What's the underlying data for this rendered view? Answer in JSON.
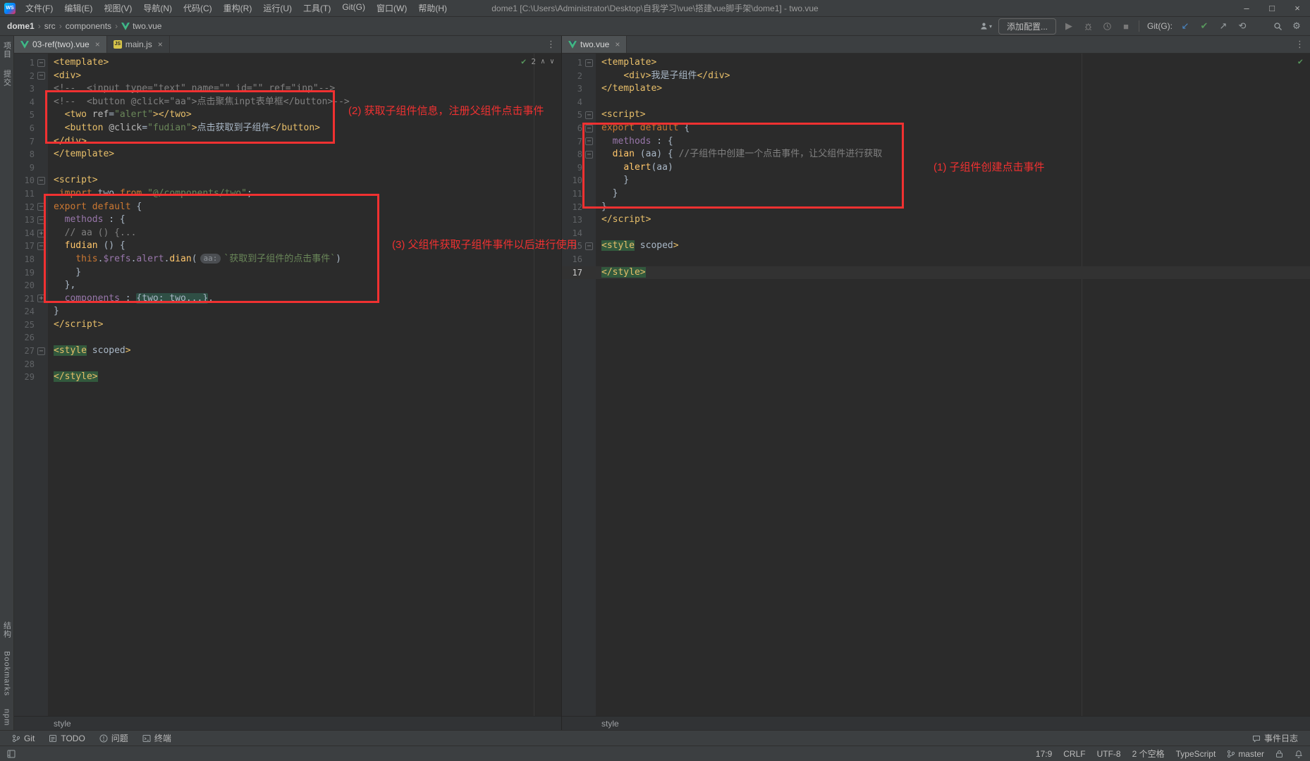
{
  "title_bar": {
    "logo": "WS",
    "menus": [
      "文件(F)",
      "编辑(E)",
      "视图(V)",
      "导航(N)",
      "代码(C)",
      "重构(R)",
      "运行(U)",
      "工具(T)",
      "Git(G)",
      "窗口(W)",
      "帮助(H)"
    ],
    "title": "dome1 [C:\\Users\\Administrator\\Desktop\\自我学习\\vue\\搭建vue脚手架\\dome1] - two.vue"
  },
  "toolbar": {
    "breadcrumbs": [
      {
        "label": "dome1"
      },
      {
        "label": "src"
      },
      {
        "label": "components"
      },
      {
        "label": "two.vue",
        "icon": "vue"
      }
    ],
    "add_config_label": "添加配置...",
    "git_label": "Git(G):"
  },
  "icons": {
    "close": "×",
    "kebab": "⋮",
    "crumb_sep": "›",
    "check": "✔",
    "chev_up": "∧",
    "chev_down": "∨",
    "play": "▶",
    "stop": "■",
    "gear": "⚙",
    "git_update": "↙",
    "git_commit": "✔",
    "git_push": "↗",
    "git_history": "⟲",
    "dropdown": "▾",
    "minimize": "–",
    "maximize": "□",
    "close_win": "×",
    "fold_open": "−",
    "fold_closed": "+"
  },
  "left_stripe": {
    "top": [
      "项目",
      "提交"
    ],
    "bottom": [
      "结构",
      "Bookmarks",
      "npm"
    ]
  },
  "panes": [
    {
      "tabs": [
        {
          "label": "03-ref(two).vue",
          "icon": "vue",
          "selected": true
        },
        {
          "label": "main.js",
          "icon": "js",
          "selected": false
        }
      ],
      "inspection": {
        "count": "2"
      },
      "breadcrumb": "style",
      "lines": [
        {
          "n": "1",
          "f": "m",
          "s": [
            [
              "tag",
              "<template>"
            ]
          ]
        },
        {
          "n": "2",
          "f": "m",
          "s": [
            [
              "tag",
              "<div>"
            ]
          ]
        },
        {
          "n": "3",
          "f": "",
          "s": [
            [
              "cmt",
              "<!--  <input type=\"text\" name=\"\" id=\"\" ref=\"inp\"-->"
            ]
          ]
        },
        {
          "n": "4",
          "f": "",
          "s": [
            [
              "cmt",
              "<!--  <button @click=\"aa\">点击聚焦inpt表单框</button>-->"
            ]
          ]
        },
        {
          "n": "5",
          "f": "",
          "s": [
            [
              "txt",
              "  "
            ],
            [
              "tag",
              "<two"
            ],
            [
              "attr",
              " ref"
            ],
            [
              "txt",
              "="
            ],
            [
              "str",
              "\"alert\""
            ],
            [
              "tag",
              "></two>"
            ]
          ]
        },
        {
          "n": "6",
          "f": "",
          "s": [
            [
              "txt",
              "  "
            ],
            [
              "tag",
              "<button"
            ],
            [
              "attr",
              " @click"
            ],
            [
              "txt",
              "="
            ],
            [
              "str",
              "\"fudian\""
            ],
            [
              "tag",
              ">"
            ],
            [
              "txt",
              "点击获取到子组件"
            ],
            [
              "tag",
              "</button>"
            ]
          ]
        },
        {
          "n": "7",
          "f": "",
          "s": [
            [
              "tag",
              "</div>"
            ]
          ]
        },
        {
          "n": "8",
          "f": "",
          "s": [
            [
              "tag",
              "</template>"
            ]
          ]
        },
        {
          "n": "9",
          "f": "",
          "s": []
        },
        {
          "n": "10",
          "f": "m",
          "s": [
            [
              "tag",
              "<script>"
            ]
          ]
        },
        {
          "n": "11",
          "f": "",
          "s": [
            [
              "txt",
              " "
            ],
            [
              "kw",
              "import "
            ],
            [
              "ident",
              "two"
            ],
            [
              "kw",
              " from "
            ],
            [
              "str",
              "\"@/components/two\""
            ],
            [
              "txt",
              ";"
            ]
          ]
        },
        {
          "n": "12",
          "f": "m",
          "s": [
            [
              "kw",
              "export default "
            ],
            [
              "txt",
              "{"
            ]
          ]
        },
        {
          "n": "13",
          "f": "m",
          "s": [
            [
              "txt",
              "  "
            ],
            [
              "prop",
              "methods"
            ],
            [
              "txt",
              " : {"
            ]
          ]
        },
        {
          "n": "14",
          "f": "p",
          "s": [
            [
              "txt",
              "  "
            ],
            [
              "cmt",
              "// aa () {..."
            ]
          ]
        },
        {
          "n": "17",
          "f": "m",
          "s": [
            [
              "txt",
              "  "
            ],
            [
              "fn",
              "fudian"
            ],
            [
              "txt",
              " () {"
            ]
          ]
        },
        {
          "n": "18",
          "f": "",
          "s": [
            [
              "txt",
              "    "
            ],
            [
              "kw",
              "this"
            ],
            [
              "txt",
              "."
            ],
            [
              "prop",
              "$refs"
            ],
            [
              "txt",
              "."
            ],
            [
              "prop",
              "alert"
            ],
            [
              "txt",
              "."
            ],
            [
              "fn",
              "dian"
            ],
            [
              "txt",
              "("
            ],
            [
              "hint",
              "aa:"
            ],
            [
              "str",
              "`获取到子组件的点击事件`"
            ],
            [
              "txt",
              ")"
            ]
          ]
        },
        {
          "n": "19",
          "f": "",
          "s": [
            [
              "txt",
              "    }"
            ]
          ]
        },
        {
          "n": "20",
          "f": "",
          "s": [
            [
              "txt",
              "  },"
            ]
          ]
        },
        {
          "n": "21",
          "f": "p",
          "s": [
            [
              "txt",
              "  "
            ],
            [
              "prop",
              "components"
            ],
            [
              "txt",
              " : "
            ],
            [
              "foldtx",
              "{two: two...}"
            ],
            [
              "txt",
              ","
            ]
          ]
        },
        {
          "n": "24",
          "f": "",
          "s": [
            [
              "txt",
              "}"
            ]
          ]
        },
        {
          "n": "25",
          "f": "",
          "s": [
            [
              "tag",
              "</script>"
            ]
          ]
        },
        {
          "n": "26",
          "f": "",
          "s": []
        },
        {
          "n": "27",
          "f": "m",
          "s": [
            [
              "taghl",
              "<style"
            ],
            [
              "txt",
              " scoped"
            ],
            [
              "tag",
              ">"
            ]
          ]
        },
        {
          "n": "28",
          "f": "",
          "s": []
        },
        {
          "n": "29",
          "f": "",
          "s": [
            [
              "taghl",
              "</style>"
            ]
          ]
        }
      ]
    },
    {
      "tabs": [
        {
          "label": "two.vue",
          "icon": "vue",
          "selected": true
        }
      ],
      "inspection": {},
      "breadcrumb": "style",
      "lines": [
        {
          "n": "1",
          "f": "m",
          "s": [
            [
              "tag",
              "<template>"
            ]
          ]
        },
        {
          "n": "2",
          "f": "",
          "s": [
            [
              "txt",
              "    "
            ],
            [
              "tag",
              "<div>"
            ],
            [
              "txt",
              "我是子组件"
            ],
            [
              "tag",
              "</div>"
            ]
          ]
        },
        {
          "n": "3",
          "f": "",
          "s": [
            [
              "tag",
              "</template>"
            ]
          ]
        },
        {
          "n": "4",
          "f": "",
          "s": []
        },
        {
          "n": "5",
          "f": "m",
          "s": [
            [
              "tag",
              "<script>"
            ]
          ]
        },
        {
          "n": "6",
          "f": "m",
          "s": [
            [
              "kw",
              "export default "
            ],
            [
              "txt",
              "{"
            ]
          ]
        },
        {
          "n": "7",
          "f": "m",
          "s": [
            [
              "txt",
              "  "
            ],
            [
              "prop",
              "methods"
            ],
            [
              "txt",
              " : {"
            ]
          ]
        },
        {
          "n": "8",
          "f": "m",
          "s": [
            [
              "txt",
              "  "
            ],
            [
              "fn",
              "dian"
            ],
            [
              "txt",
              " ("
            ],
            [
              "ident",
              "aa"
            ],
            [
              "txt",
              ") { "
            ],
            [
              "cmt",
              "//子组件中创建一个点击事件，让父组件进行获取"
            ]
          ]
        },
        {
          "n": "9",
          "f": "",
          "s": [
            [
              "txt",
              "    "
            ],
            [
              "fn",
              "alert"
            ],
            [
              "txt",
              "("
            ],
            [
              "ident",
              "aa"
            ],
            [
              "txt",
              ")"
            ]
          ]
        },
        {
          "n": "10",
          "f": "",
          "s": [
            [
              "txt",
              "    }"
            ]
          ]
        },
        {
          "n": "11",
          "f": "",
          "s": [
            [
              "txt",
              "  }"
            ]
          ]
        },
        {
          "n": "12",
          "f": "",
          "s": [
            [
              "txt",
              "}"
            ]
          ]
        },
        {
          "n": "13",
          "f": "",
          "s": [
            [
              "tag",
              "</script>"
            ]
          ]
        },
        {
          "n": "14",
          "f": "",
          "s": []
        },
        {
          "n": "15",
          "f": "m",
          "s": [
            [
              "taghl",
              "<style"
            ],
            [
              "txt",
              " scoped"
            ],
            [
              "tag",
              ">"
            ]
          ]
        },
        {
          "n": "16",
          "f": "",
          "s": []
        },
        {
          "n": "17",
          "f": "",
          "hl": true,
          "s": [
            [
              "taghl",
              "</style>"
            ]
          ]
        }
      ]
    }
  ],
  "annotations": [
    {
      "text": "(2) 获取子组件信息，注册父组件点击事件"
    },
    {
      "text": "(3) 父组件获取子组件事件以后进行使用"
    },
    {
      "text": "(1) 子组件创建点击事件"
    }
  ],
  "tool_buttons": {
    "left": [
      {
        "icon": "branch",
        "label": "Git"
      },
      {
        "icon": "todo",
        "label": "TODO"
      },
      {
        "icon": "problems",
        "label": "问题"
      },
      {
        "icon": "terminal",
        "label": "终端"
      }
    ],
    "right": [
      {
        "icon": "event-log",
        "label": "事件日志"
      }
    ]
  },
  "status_bar": {
    "items": [
      "17:9",
      "CRLF",
      "UTF-8",
      "2 个空格",
      "TypeScript"
    ],
    "branch": "master"
  }
}
